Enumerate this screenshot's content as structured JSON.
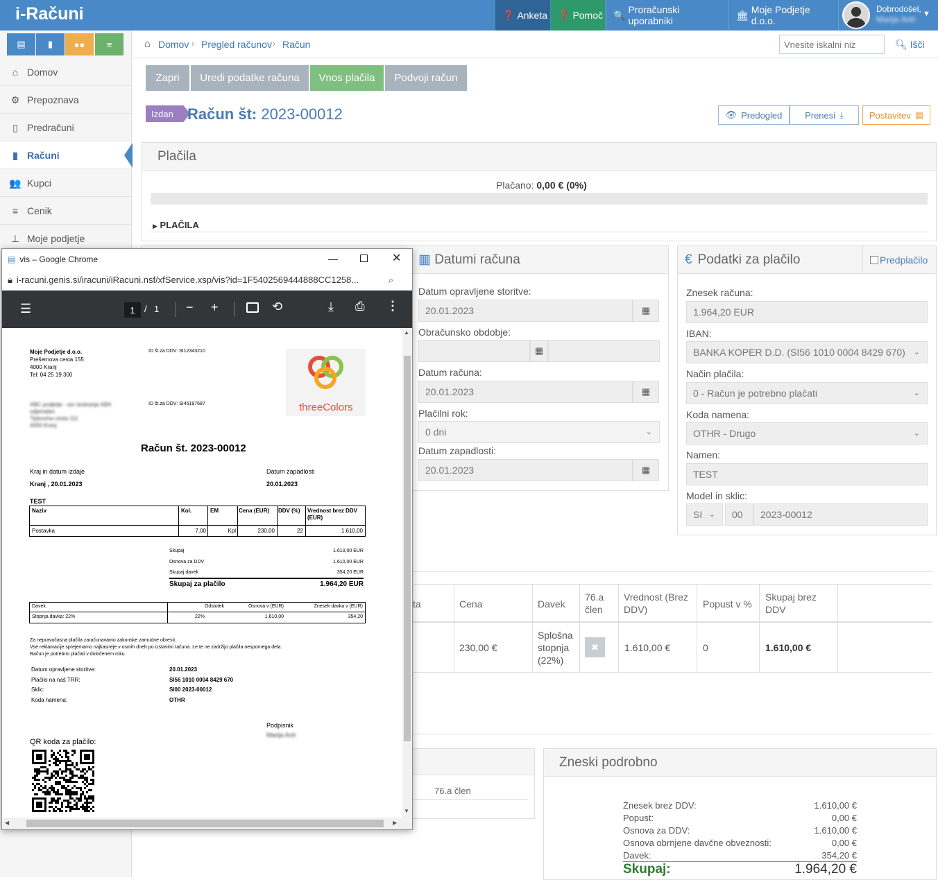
{
  "app": {
    "logo": "i-Računi",
    "nav": [
      {
        "label": "Anketa",
        "icon": "question-circle-icon",
        "color": "#2f6596"
      },
      {
        "label": "Pomoč",
        "icon": "question-circle-icon",
        "color": "#2e9a6b"
      },
      {
        "label": "Proračunski uporabniki",
        "icon": "search-icon",
        "color": "#4a89c8"
      },
      {
        "label": "Moje Podjetje d.o.o.",
        "icon": "bank-icon",
        "color": "#4a89c8"
      }
    ],
    "user": {
      "greeting": "Dobrodošel,",
      "name": "Marija Anh"
    }
  },
  "sidebar": {
    "quick": [
      {
        "icon": "invoice-p-icon",
        "color": "#4a89c8"
      },
      {
        "icon": "document-icon",
        "color": "#4a89c8"
      },
      {
        "icon": "users-icon",
        "color": "#f0ad4e"
      },
      {
        "icon": "list-icon",
        "color": "#6cb26c"
      }
    ],
    "items": [
      {
        "label": "Domov",
        "icon": "home-icon"
      },
      {
        "label": "Prepoznava",
        "icon": "gears-icon"
      },
      {
        "label": "Predračuni",
        "icon": "document-icon"
      },
      {
        "label": "Računi",
        "icon": "document-icon",
        "active": true
      },
      {
        "label": "Kupci",
        "icon": "users-icon"
      },
      {
        "label": "Cenik",
        "icon": "list-icon"
      },
      {
        "label": "Moje podjetje",
        "icon": "sitemap-icon"
      }
    ]
  },
  "breadcrumb": [
    "Domov",
    "Pregled računov",
    "Račun"
  ],
  "search": {
    "placeholder": "Vnesite iskalni niz",
    "button": "Išči"
  },
  "actions": [
    {
      "label": "Zapri",
      "color": "#a7b2bc"
    },
    {
      "label": "Uredi podatke računa",
      "color": "#a7b2bc"
    },
    {
      "label": "Vnos plačila",
      "color": "#7fbf7f"
    },
    {
      "label": "Podvoji račun",
      "color": "#a7b2bc"
    }
  ],
  "invoice": {
    "status": "Izdan",
    "title_prefix": "Račun št:",
    "number": "2023-00012"
  },
  "right_buttons": {
    "preview": "Predogled",
    "download": "Prenesi",
    "settings": "Postavitev"
  },
  "payments": {
    "title": "Plačila",
    "paid_label": "Plačano:",
    "paid_value": "0,00 € (0%)",
    "progress": 0,
    "section": "PLAČILA"
  },
  "dates": {
    "title": "Datumi računa",
    "service_date_label": "Datum opravljene storitve:",
    "service_date": "20.01.2023",
    "period_label": "Obračunsko obdobje:",
    "invoice_date_label": "Datum računa:",
    "invoice_date": "20.01.2023",
    "due_label": "Plačilni rok:",
    "due_value": "0 dni",
    "due_date_label": "Datum zapadlosti:",
    "due_date": "20.01.2023"
  },
  "paydata": {
    "title": "Podatki za plačilo",
    "prepay": "Predplačilo",
    "amount_label": "Znesek računa:",
    "amount": "1.964,20 EUR",
    "iban_label": "IBAN:",
    "iban": "BANKA KOPER D.D. (SI56 1010 0004 8429 670)",
    "method_label": "Način plačila:",
    "method": "0 - Račun je potrebno plačati",
    "purpose_code_label": "Koda namena:",
    "purpose_code": "OTHR - Drugo",
    "purpose_label": "Namen:",
    "purpose": "TEST",
    "model_label": "Model in sklic:",
    "model": "SI",
    "model2": "00",
    "reference": "2023-00012"
  },
  "items_table": {
    "headers": [
      "ta",
      "Cena",
      "Davek",
      "76.a člen",
      "Vrednost (Brez DDV)",
      "Popust v %",
      "Skupaj brez DDV"
    ],
    "row": {
      "price": "230,00 €",
      "tax": "Splošna stopnja (22%)",
      "value": "1.610,00 €",
      "discount": "0",
      "total": "1.610,00 €"
    }
  },
  "tax_panel": {
    "label": "76.a člen"
  },
  "amounts": {
    "title": "Zneski podrobno",
    "rows": [
      {
        "label": "Znesek brez DDV:",
        "value": "1.610,00 €"
      },
      {
        "label": "Popust:",
        "value": "0,00 €"
      },
      {
        "label": "Osnova za DDV:",
        "value": "1.610,00 €"
      },
      {
        "label": "Osnova obrnjene davčne obveznosti:",
        "value": "0,00 €"
      },
      {
        "label": "Davek:",
        "value": "354,20 €"
      }
    ],
    "total_label": "Skupaj:",
    "total_value": "1.964,20 €"
  },
  "chrome": {
    "title": "vis – Google Chrome",
    "url": "i-racuni.genis.si/iracuni/iRacuni.nsf/xfService.xsp/vis?id=1F5402569444888CC1258...",
    "page": "1",
    "page_sep": "/",
    "pages": "1"
  },
  "pdf": {
    "company": "Moje Podjetje d.o.o.",
    "street": "Prešernova cesta 155",
    "city": "4000 Kranj",
    "tel": "Tel: 04 25 19 300",
    "vat_own": "ID št.za DDV: SI12343210",
    "vat_buyer": "ID št.za DDV: SI45197687",
    "buyer_lines": [
      "ABC podjetje - ser testiranje ABA",
      "odjemalec",
      "Tipkovina cesta 111",
      "4000 Kranj"
    ],
    "logo_text": "threeColors",
    "title": "Račun št. 2023-00012",
    "place_date_label": "Kraj in datum izdaje",
    "place_date": "Kranj , 20.01.2023",
    "due_label": "Datum zapadlosti",
    "due": "20.01.2023",
    "note": "TEST",
    "cols": [
      "Naziv",
      "Kol.",
      "EM",
      "Cena (EUR)",
      "DDV (%)",
      "Vrednost brez DDV (EUR)"
    ],
    "row": [
      "Postavka",
      "7,00",
      "Kpl",
      "230,00",
      "22",
      "1.610,00"
    ],
    "sums": [
      {
        "label": "Skupaj",
        "value": "1.610,00 EUR"
      },
      {
        "label": "Osnova za DDV",
        "value": "1.610,00 EUR"
      },
      {
        "label": "Skupaj davek",
        "value": "354,20 EUR"
      }
    ],
    "total_label": "Skupaj za plačilo",
    "total": "1.964,20 EUR",
    "tax_cols": [
      "Davek",
      "Odstotek",
      "Osnova v (EUR)",
      "Znesek davka v (EUR)"
    ],
    "tax_row": [
      "Stopnja davka: 22%",
      "22%",
      "1.610,00",
      "354,20"
    ],
    "footer1": "Za nepravočasna plačila zaračunavamo zakonske zamudne obresti.",
    "footer2": "Vse reklamacije sprejemamo najkasneje v osmih dneh po izstavitvi računa. Le te ne zadržijo plačila nespornega dela.",
    "footer3": "Račun je potrebno plačati v določenem roku.",
    "info": [
      {
        "label": "Datum opravljene storitve:",
        "value": "20.01.2023"
      },
      {
        "label": "Plačilo na naš TRR:",
        "value": "SI56 1010 0004 8429 670"
      },
      {
        "label": "Sklic:",
        "value": "SI00 2023-00012"
      },
      {
        "label": "Koda namena:",
        "value": "OTHR"
      }
    ],
    "signer_label": "Podpisnik",
    "signer": "Marija Anh",
    "qr_label": "QR koda za plačilo:"
  }
}
